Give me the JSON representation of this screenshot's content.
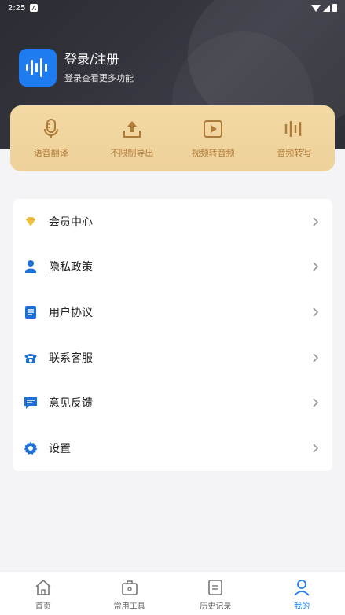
{
  "status_bar": {
    "time": "2:25",
    "notification": "A"
  },
  "profile": {
    "title": "登录/注册",
    "subtitle": "登录查看更多功能"
  },
  "quick_actions": [
    {
      "label": "语音翻译",
      "icon": "microphone-icon"
    },
    {
      "label": "不限制导出",
      "icon": "export-icon"
    },
    {
      "label": "视频转音频",
      "icon": "video-icon"
    },
    {
      "label": "音频转写",
      "icon": "audio-bars-icon"
    }
  ],
  "menu": [
    {
      "label": "会员中心",
      "icon": "diamond-icon",
      "color": "#f0c040"
    },
    {
      "label": "隐私政策",
      "icon": "person-icon",
      "color": "#1e6fd8"
    },
    {
      "label": "用户协议",
      "icon": "document-icon",
      "color": "#1e6fd8"
    },
    {
      "label": "联系客服",
      "icon": "phone-icon",
      "color": "#1e6fd8"
    },
    {
      "label": "意见反馈",
      "icon": "feedback-icon",
      "color": "#1e6fd8"
    },
    {
      "label": "设置",
      "icon": "gear-icon",
      "color": "#1e6fd8"
    }
  ],
  "tabs": [
    {
      "label": "首页",
      "icon": "home-icon"
    },
    {
      "label": "常用工具",
      "icon": "toolbox-icon"
    },
    {
      "label": "历史记录",
      "icon": "history-icon"
    },
    {
      "label": "我的",
      "icon": "user-icon",
      "active": true
    }
  ],
  "colors": {
    "accent": "#1e7cf0",
    "gold": "#b07a38"
  }
}
